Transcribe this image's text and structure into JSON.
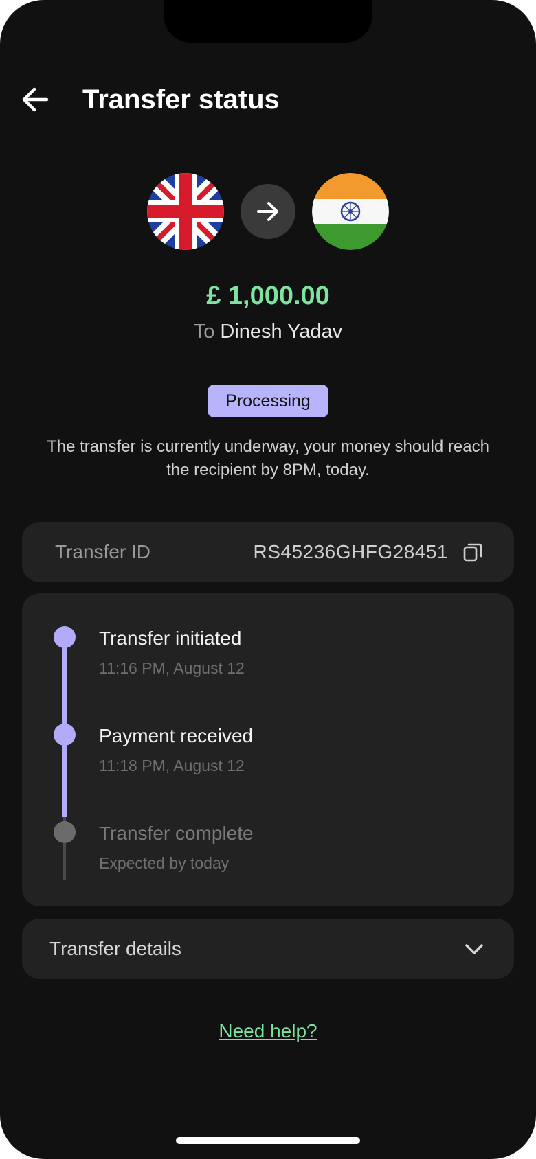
{
  "header": {
    "title": "Transfer status"
  },
  "transfer": {
    "from_flag": "uk-flag-icon",
    "to_flag": "india-flag-icon",
    "amount": "£ 1,000.00",
    "to_prefix": "To",
    "recipient_name": "Dinesh Yadav",
    "status": "Processing",
    "status_description": "The transfer is currently underway, your money should reach the recipient by 8PM, today."
  },
  "transfer_id": {
    "label": "Transfer ID",
    "value": "RS45236GHFG28451"
  },
  "timeline": {
    "steps": [
      {
        "title": "Transfer initiated",
        "time": "11:16 PM, August 12",
        "state": "done"
      },
      {
        "title": "Payment received",
        "time": "11:18 PM, August 12",
        "state": "done"
      },
      {
        "title": "Transfer complete",
        "time": "Expected by today",
        "state": "pending"
      }
    ]
  },
  "details": {
    "label": "Transfer details"
  },
  "help": {
    "label": "Need help?"
  },
  "colors": {
    "background": "#111111",
    "card": "#222222",
    "accent_green": "#7ee2a1",
    "accent_purple": "#b3abf7",
    "badge": "#b8b4fb"
  }
}
